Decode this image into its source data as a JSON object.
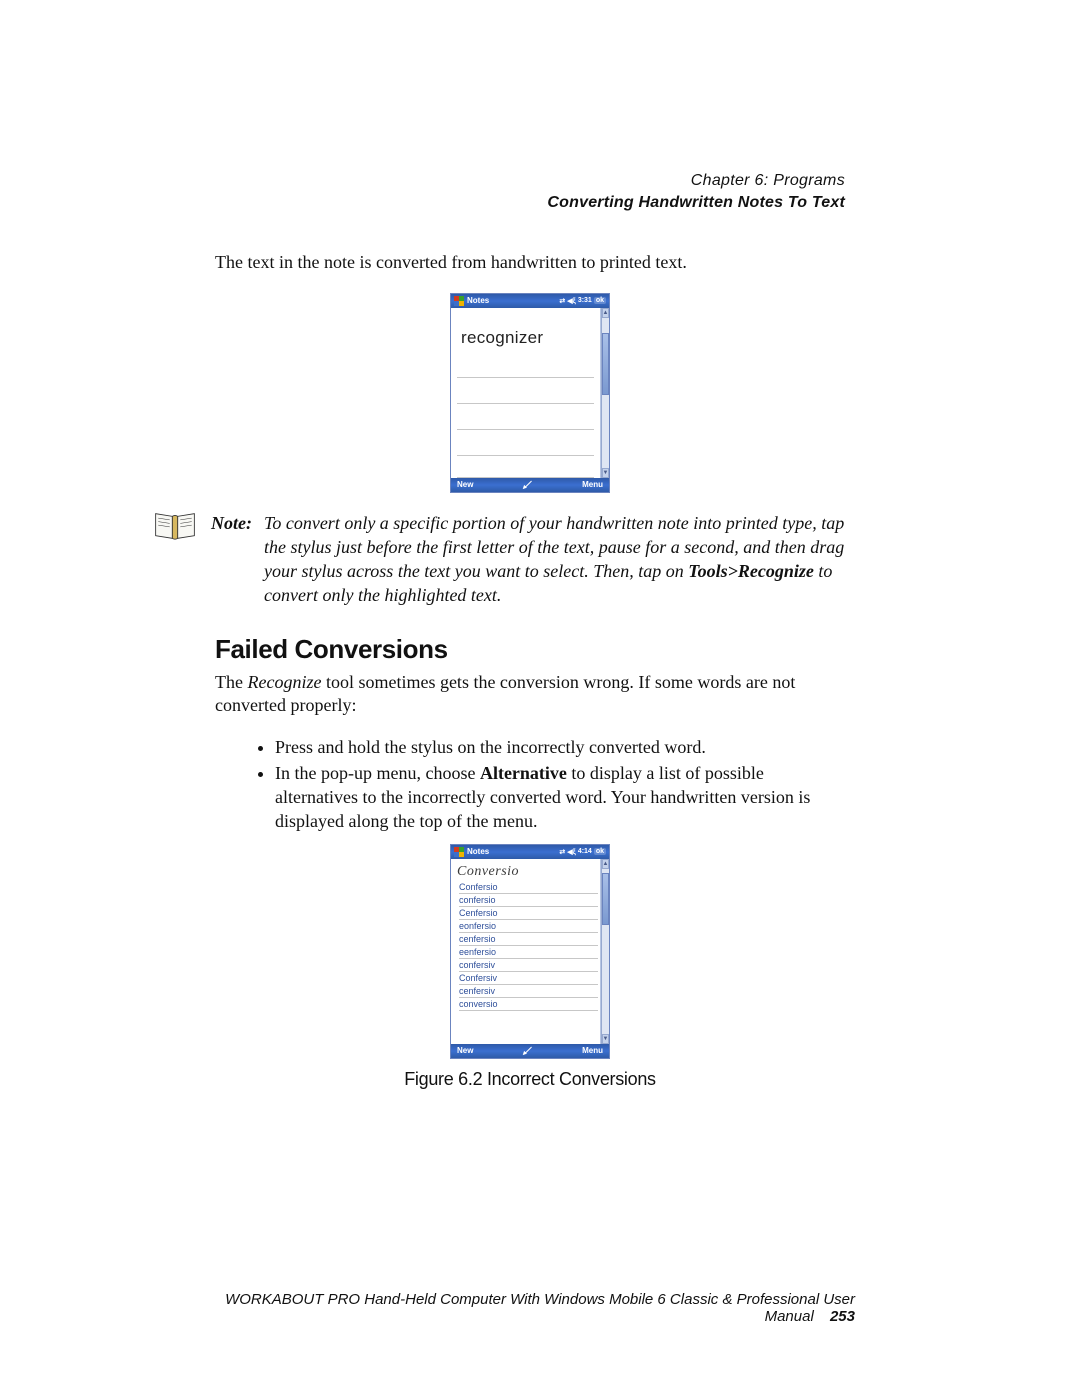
{
  "header": {
    "chapter_line": "Chapter 6: Programs",
    "section_line": "Converting Handwritten Notes To Text"
  },
  "intro": "The text in the note is converted from handwritten to printed text.",
  "pda1": {
    "title": "Notes",
    "time": "3:31",
    "ok": "ok",
    "word": "recognizer",
    "new": "New",
    "menu": "Menu"
  },
  "note": {
    "label": "Note:",
    "text_pre": "To convert only a specific portion of your handwritten note into printed type, tap the stylus just before the first letter of the text, pause for a second, and then drag your stylus across the text you want to select. Then, tap on ",
    "tools": "Tools>Recognize",
    "text_post": " to convert only the highlighted text."
  },
  "h3": "Failed Conversions",
  "p_failed_pre": "The ",
  "p_failed_em": "Recognize",
  "p_failed_post": " tool sometimes gets the conversion wrong. If some words are not converted properly:",
  "bullets": {
    "b1": "Press and hold the stylus on the incorrectly converted word.",
    "b2_pre": "In the pop-up menu, choose ",
    "b2_bold": "Alternative",
    "b2_post": " to display a list of possible alternatives to the incorrectly converted word. Your handwritten version is displayed along the top of the menu."
  },
  "pda2": {
    "title": "Notes",
    "time": "4:14",
    "ok": "ok",
    "handwritten": "Conversio",
    "alternatives": [
      "Confersio",
      "confersio",
      "Cenfersio",
      "eonfersio",
      "cenfersio",
      "eenfersio",
      "confersiv",
      "Confersiv",
      "cenfersiv",
      "conversio"
    ],
    "new": "New",
    "menu": "Menu"
  },
  "figcap": "Figure 6.2 Incorrect Conversions",
  "footer": {
    "text": "WORKABOUT PRO Hand-Held Computer With Windows Mobile 6 Classic & Professional User Manual",
    "page": "253"
  }
}
